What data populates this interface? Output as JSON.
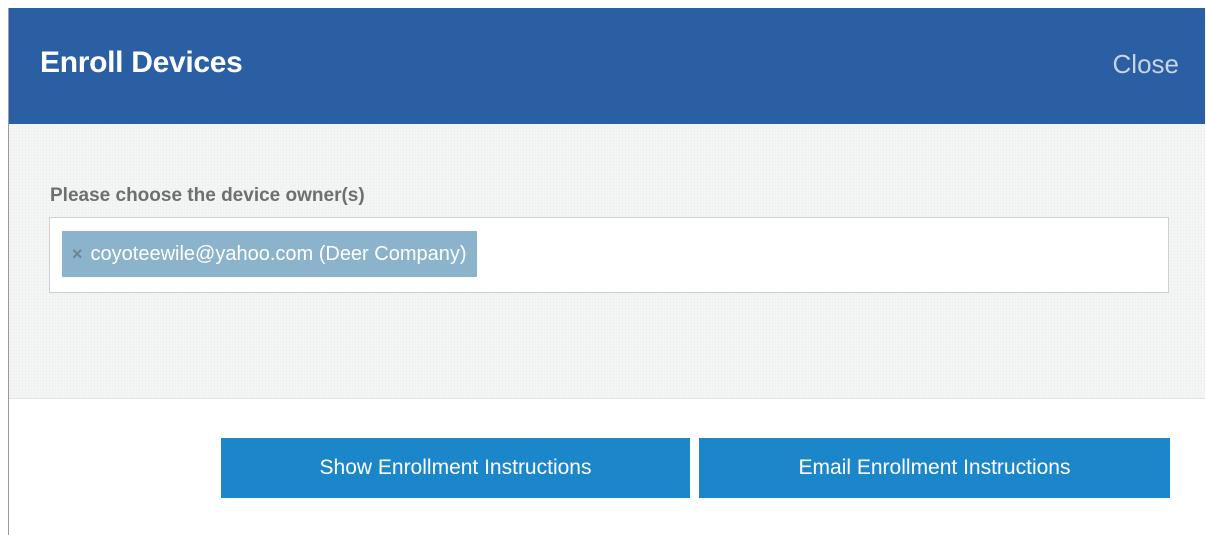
{
  "dialog": {
    "title": "Enroll Devices",
    "close_label": "Close"
  },
  "owner_field": {
    "label": "Please choose the device owner(s)",
    "selected": [
      {
        "remove_icon": "×",
        "text": "coyoteewile@yahoo.com (Deer Company)"
      }
    ]
  },
  "actions": {
    "show_label": "Show Enrollment Instructions",
    "email_label": "Email Enrollment Instructions"
  },
  "colors": {
    "header": "#2b5fa3",
    "button": "#1b86c9",
    "tag": "#8bb3cc"
  }
}
